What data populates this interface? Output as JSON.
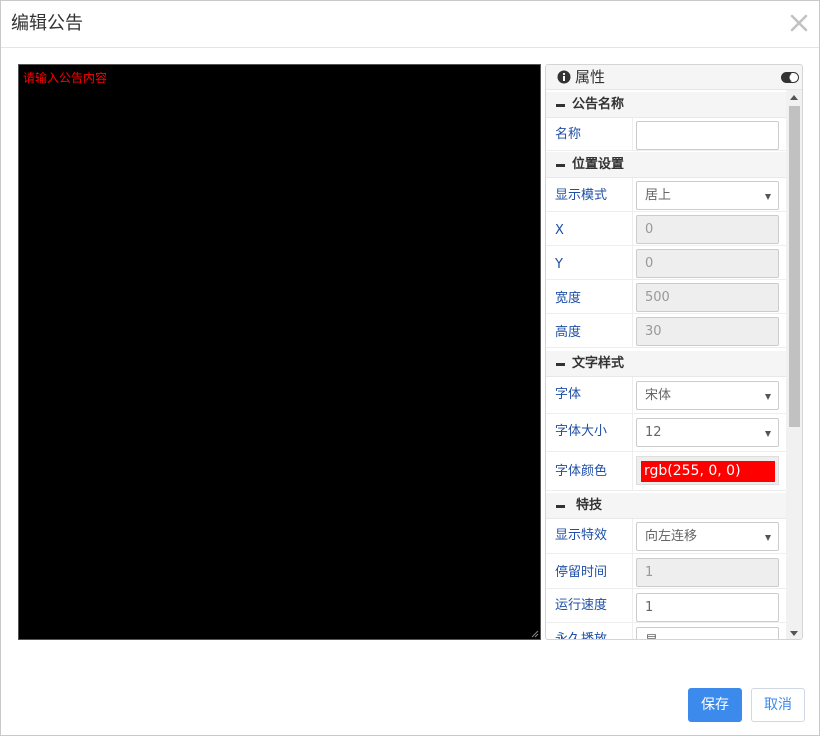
{
  "dialog": {
    "title": "编辑公告",
    "close_icon": "close-icon"
  },
  "editor": {
    "placeholder": "请输入公告内容",
    "text_color": "#ff0000",
    "background": "#000000"
  },
  "panel": {
    "title": "属性",
    "info_icon": "info-icon",
    "toggle_icon": "toggle-icon",
    "groups": {
      "name_group": "公告名称",
      "position_group": "位置设置",
      "text_group": "文字样式",
      "effect_group": "特技"
    },
    "fields": {
      "name": {
        "label": "名称",
        "value": ""
      },
      "display_mode": {
        "label": "显示模式",
        "value": "居上"
      },
      "x": {
        "label": "X",
        "value": "0"
      },
      "y": {
        "label": "Y",
        "value": "0"
      },
      "width": {
        "label": "宽度",
        "value": "500"
      },
      "height": {
        "label": "高度",
        "value": "30"
      },
      "font": {
        "label": "字体",
        "value": "宋体"
      },
      "font_size": {
        "label": "字体大小",
        "value": "12"
      },
      "font_color": {
        "label": "字体颜色",
        "value": "rgb(255, 0, 0)"
      },
      "effect": {
        "label": "显示特效",
        "value": "向左连移"
      },
      "stay_time": {
        "label": "停留时间",
        "value": "1"
      },
      "speed": {
        "label": "运行速度",
        "value": "1"
      },
      "loop": {
        "label": "永久播放",
        "value": "是"
      }
    }
  },
  "buttons": {
    "save": "保存",
    "cancel": "取消"
  },
  "colors": {
    "accent": "#3c8bec",
    "label_blue": "#1f4fa6",
    "font_color_swatch": "#ff0000"
  }
}
